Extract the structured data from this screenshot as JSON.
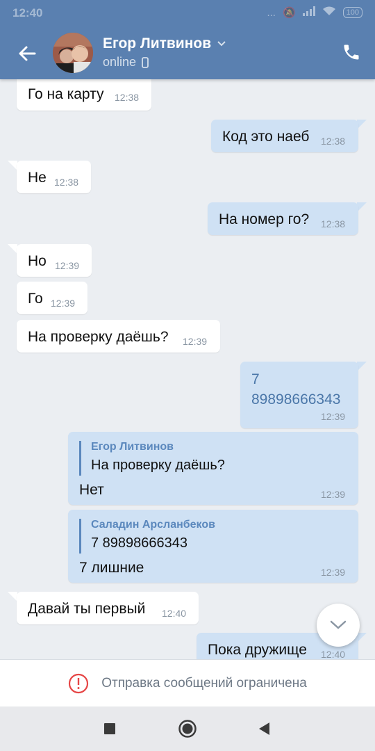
{
  "status_bar": {
    "time": "12:40",
    "icons": "...",
    "battery": "100"
  },
  "header": {
    "contact_name": "Егор Литвинов",
    "status": "online"
  },
  "messages": [
    {
      "dir": "in",
      "text": "Го на карту",
      "time": "12:38"
    },
    {
      "dir": "out",
      "text": "Код это наеб",
      "time": "12:38"
    },
    {
      "dir": "in",
      "text": "Не",
      "time": "12:38"
    },
    {
      "dir": "out",
      "text": "На номер го?",
      "time": "12:38"
    },
    {
      "dir": "in",
      "text": "Но",
      "time": "12:39"
    },
    {
      "dir": "in",
      "text": "Го",
      "time": "12:39"
    },
    {
      "dir": "in",
      "text": "На проверку даёшь?",
      "time": "12:39"
    },
    {
      "dir": "out",
      "text_line1": "7",
      "text_line2": "89898666343",
      "time": "12:39"
    },
    {
      "dir": "out",
      "quote_author": "Егор Литвинов",
      "quote_text": "На проверку даёшь?",
      "text": "Нет",
      "time": "12:39"
    },
    {
      "dir": "out",
      "quote_author": "Саладин Арсланбеков",
      "quote_text": "7 89898666343",
      "text": "7 лишние",
      "time": "12:39"
    },
    {
      "dir": "in",
      "text": "Давай ты первый",
      "time": "12:40"
    },
    {
      "dir": "out",
      "text": "Пока дружище",
      "time": "12:40"
    }
  ],
  "restriction_notice": "Отправка сообщений ограничена",
  "colors": {
    "header": "#5a80b0",
    "incoming": "#ffffff",
    "outgoing": "#cfe1f4",
    "background": "#ebeef2",
    "alert": "#e64646"
  }
}
